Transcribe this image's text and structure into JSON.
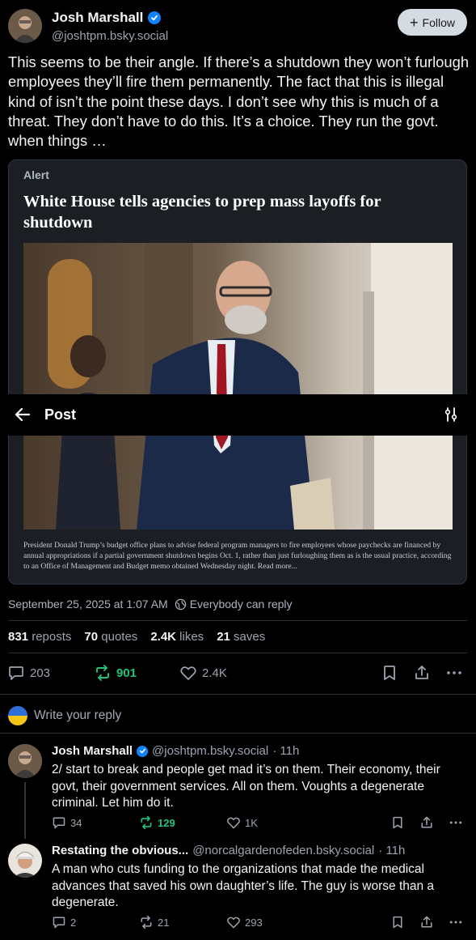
{
  "author": {
    "name": "Josh Marshall",
    "handle": "@joshtpm.bsky.social",
    "follow_label": "Follow"
  },
  "post": {
    "text": "This seems to be their angle. If there’s a shutdown they won’t furlough employees they’ll fire them permanently. The fact that this is illegal kind of isn’t the point these days. I don’t see why this is much of a threat. They don’t have to do this. It’s a choice. They run the govt. when things …",
    "embed": {
      "label": "Alert",
      "headline": "White House tells agencies to prep mass layoffs for shutdown",
      "caption": "President Donald Trump’s budget office plans to advise federal program managers to fire employees whose paychecks are financed by annual appropriations if a partial government shutdown begins Oct. 1, rather than just furloughing them as is the usual practice, according to an Office of Management and Budget memo obtained Wednesday night. Read more..."
    },
    "timestamp": "September 25, 2025 at 1:07 AM",
    "reply_scope": "Everybody can reply",
    "stats": {
      "reposts_count": "831",
      "reposts_label": "reposts",
      "quotes_count": "70",
      "quotes_label": "quotes",
      "likes_count": "2.4K",
      "likes_label": "likes",
      "saves_count": "21",
      "saves_label": "saves"
    },
    "actions": {
      "replies": "203",
      "reposts": "901",
      "likes": "2.4K"
    }
  },
  "nav": {
    "title": "Post"
  },
  "composer": {
    "placeholder": "Write your reply"
  },
  "replies": [
    {
      "name": "Josh Marshall",
      "handle": "@joshtpm.bsky.social",
      "time": "· 11h",
      "text": "2/ start to break and people get mad it’s on them. Their economy, their govt, their government services. All on them. Voughts a degenerate criminal. Let him do it.",
      "replies": "34",
      "reposts": "129",
      "likes": "1K"
    },
    {
      "name": "Restating the obvious...",
      "handle": "@norcalgardenofeden.bsky.social",
      "time": "· 11h",
      "text": "A man who cuts funding to the organizations that made the medical advances that saved his own daughter’s life.  The guy is worse than a degenerate.",
      "replies": "2",
      "reposts": "21",
      "likes": "293"
    }
  ],
  "colors": {
    "background": "#000000",
    "text": "#f1f3f5",
    "muted": "#9ba4b0",
    "repost_active": "#21c27a",
    "verified": "#1083fe",
    "embed_bg": "#1b1f24",
    "border": "#2a3038"
  },
  "icons": {
    "back": "arrow-left-icon",
    "settings": "sliders-icon",
    "reply": "speech-bubble-icon",
    "repost": "repost-arrows-icon",
    "like": "heart-icon",
    "bookmark": "bookmark-icon",
    "share": "share-icon",
    "more": "ellipsis-icon",
    "audience": "globe-icon"
  }
}
